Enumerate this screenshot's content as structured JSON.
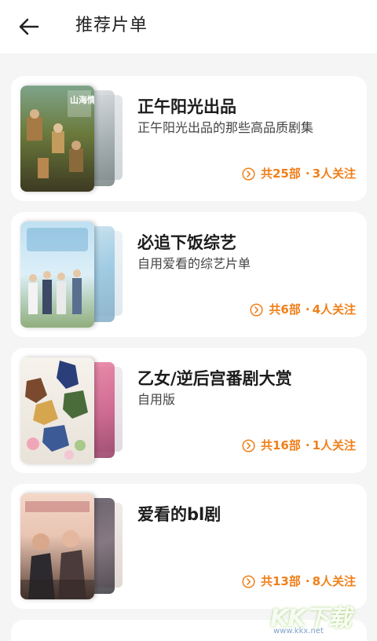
{
  "header": {
    "title": "推荐片单",
    "back_icon": "arrow-left-icon"
  },
  "colors": {
    "accent": "#f07f1a",
    "background": "#f5f5f5",
    "card": "#ffffff"
  },
  "playlists": [
    {
      "title": "正午阳光出品",
      "description": "正午阳光出品的那些高品质剧集",
      "count": "共25部",
      "followers": "3人关注",
      "separator": "·",
      "cover_text": "山海情"
    },
    {
      "title": "必追下饭综艺",
      "description": "自用爱看的综艺片单",
      "count": "共6部",
      "followers": "4人关注",
      "separator": "·"
    },
    {
      "title": "乙女/逆后宫番剧大赏",
      "description": "自用版",
      "count": "共16部",
      "followers": "1人关注",
      "separator": "·"
    },
    {
      "title": "爱看的bl剧",
      "description": "",
      "count": "共13部",
      "followers": "8人关注",
      "separator": "·"
    }
  ],
  "watermark": {
    "logo": "KK下载",
    "url": "www.kkx.net"
  }
}
